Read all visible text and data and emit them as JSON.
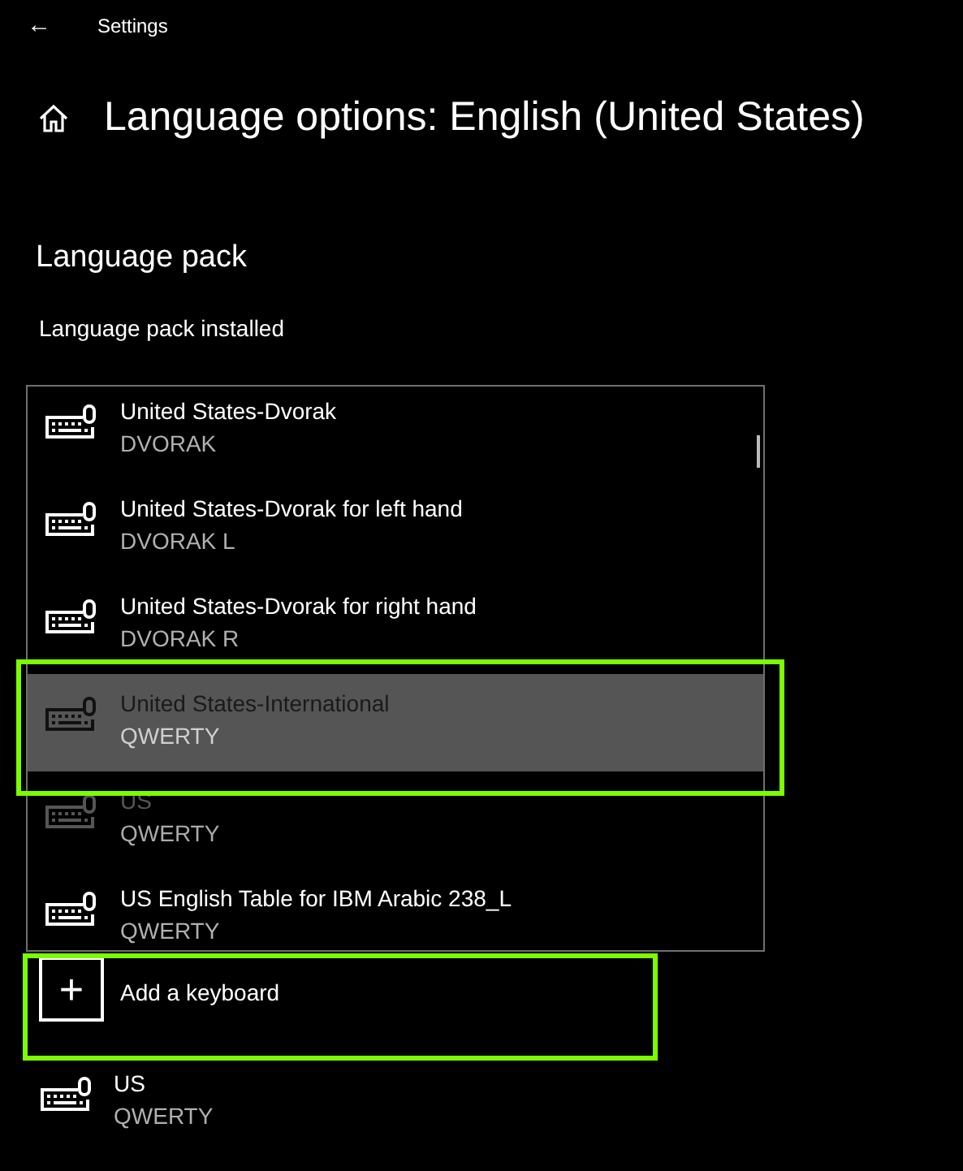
{
  "header": {
    "back": "←",
    "title": "Settings"
  },
  "page_title": "Language options: English (United States)",
  "section": {
    "title": "Language pack",
    "status": "Language pack installed"
  },
  "keyboard_list": [
    {
      "name": "United States-Dvorak",
      "layout": "DVORAK",
      "selected": false,
      "disabled": false
    },
    {
      "name": "United States-Dvorak for left hand",
      "layout": "DVORAK L",
      "selected": false,
      "disabled": false
    },
    {
      "name": "United States-Dvorak for right hand",
      "layout": "DVORAK R",
      "selected": false,
      "disabled": false
    },
    {
      "name": "United States-International",
      "layout": "QWERTY",
      "selected": true,
      "disabled": false
    },
    {
      "name": "US",
      "layout": "QWERTY",
      "selected": false,
      "disabled": true
    },
    {
      "name": "US English Table for IBM Arabic 238_L",
      "layout": "QWERTY",
      "selected": false,
      "disabled": false
    }
  ],
  "add_keyboard": {
    "label": "Add a keyboard",
    "icon": "+"
  },
  "installed_keyboards": [
    {
      "name": "US",
      "layout": "QWERTY"
    }
  ]
}
